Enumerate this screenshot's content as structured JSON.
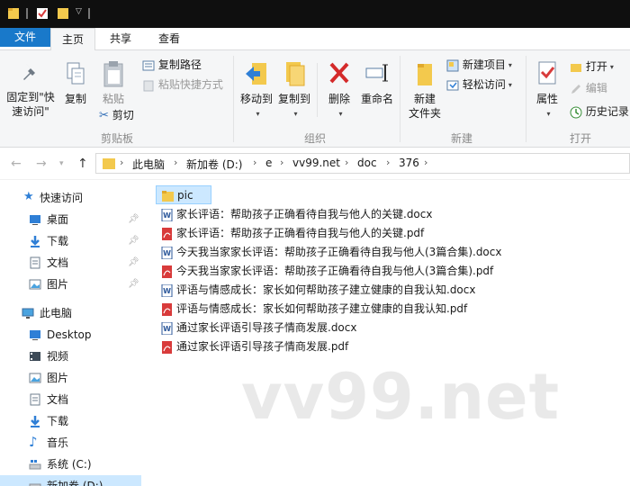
{
  "ribbon_tabs": [
    "文件",
    "主页",
    "共享",
    "查看"
  ],
  "clipboard": {
    "pin_label": "固定到\"快速访问\"",
    "copy_label": "复制",
    "paste_label": "粘贴",
    "copy_path_label": "复制路径",
    "paste_shortcut_label": "粘贴快捷方式",
    "cut_label": "剪切",
    "group_label": "剪贴板"
  },
  "organize": {
    "move_to_label": "移动到",
    "copy_to_label": "复制到",
    "delete_label": "删除",
    "rename_label": "重命名",
    "group_label": "组织"
  },
  "new": {
    "new_folder_label": "新建\n文件夹",
    "new_item_label": "新建项目",
    "easy_access_label": "轻松访问",
    "group_label": "新建"
  },
  "open": {
    "properties_label": "属性",
    "open_label": "打开",
    "edit_label": "编辑",
    "history_label": "历史记录",
    "group_label": "打开"
  },
  "breadcrumb": [
    "此电脑",
    "新加卷 (D:)",
    "e",
    "vv99.net",
    "doc",
    "376"
  ],
  "sidebar": {
    "quick_access": "快速访问",
    "quick_items": [
      "桌面",
      "下载",
      "文档",
      "图片"
    ],
    "this_pc": "此电脑",
    "pc_items": [
      "Desktop",
      "视频",
      "图片",
      "文档",
      "下载",
      "音乐",
      "系统 (C:)",
      "新加卷 (D:)"
    ]
  },
  "files": [
    {
      "name": "pic",
      "type": "folder"
    },
    {
      "name": "家长评语：帮助孩子正确看待自我与他人的关键.docx",
      "type": "docx"
    },
    {
      "name": "家长评语：帮助孩子正确看待自我与他人的关键.pdf",
      "type": "pdf"
    },
    {
      "name": "今天我当家家长评语：帮助孩子正确看待自我与他人(3篇合集).docx",
      "type": "docx"
    },
    {
      "name": "今天我当家家长评语：帮助孩子正确看待自我与他人(3篇合集).pdf",
      "type": "pdf"
    },
    {
      "name": "评语与情感成长：家长如何帮助孩子建立健康的自我认知.docx",
      "type": "docx"
    },
    {
      "name": "评语与情感成长：家长如何帮助孩子建立健康的自我认知.pdf",
      "type": "pdf"
    },
    {
      "name": "通过家长评语引导孩子情商发展.docx",
      "type": "docx"
    },
    {
      "name": "通过家长评语引导孩子情商发展.pdf",
      "type": "pdf"
    }
  ],
  "watermark": "vv99.net",
  "colors": {
    "accent": "#1979ca",
    "selection": "#cce8ff",
    "folder": "#f3c94d",
    "pdf": "#d83b3b",
    "docx": "#2b579a"
  }
}
